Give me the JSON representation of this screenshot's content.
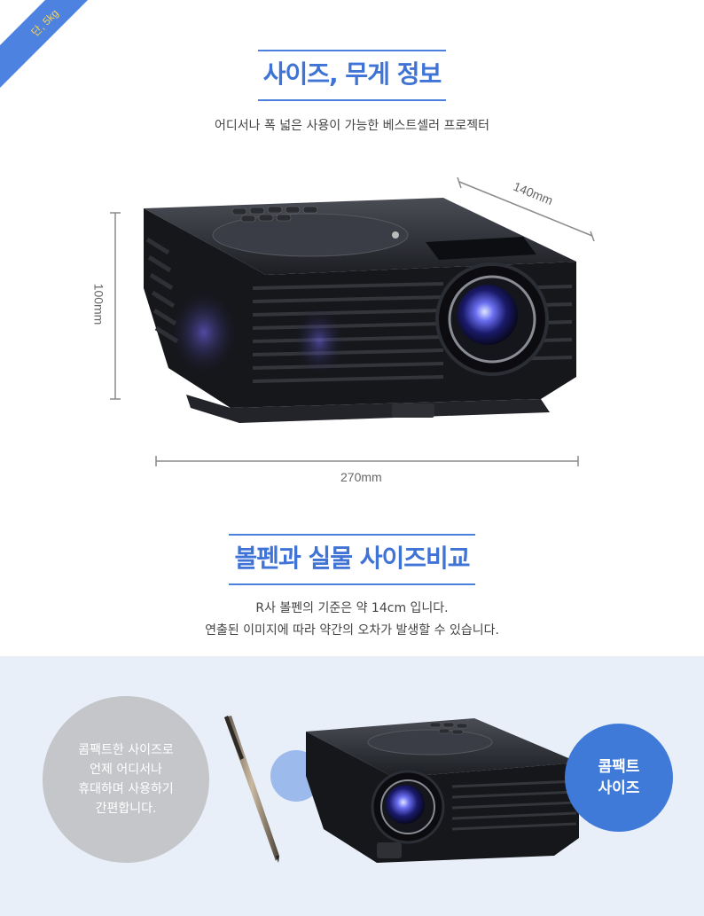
{
  "ribbon": {
    "text": "단, 5kg"
  },
  "section1": {
    "title": "사이즈, 무게 정보",
    "subtitle": "어디서나 폭 넓은 사용이 가능한 베스트셀러 프로젝터"
  },
  "dimensions": {
    "depth": "140mm",
    "height": "100mm",
    "width": "270mm"
  },
  "section2": {
    "title": "볼펜과 실물 사이즈비교",
    "line1": "R사 볼펜의 기준은 약 14cm 입니다.",
    "line2": "연출된 이미지에 따라 약간의 오차가 발생할 수 있습니다."
  },
  "compare": {
    "grey_circle": [
      "콤팩트한 사이즈로",
      "언제 어디서나",
      "휴대하며 사용하기",
      "간편합니다."
    ],
    "blue_circle": [
      "콤팩트",
      "사이즈"
    ]
  },
  "colors": {
    "accent": "#3f73d6",
    "band": "#e9eff9",
    "ribbon_text": "#ffd54a"
  }
}
